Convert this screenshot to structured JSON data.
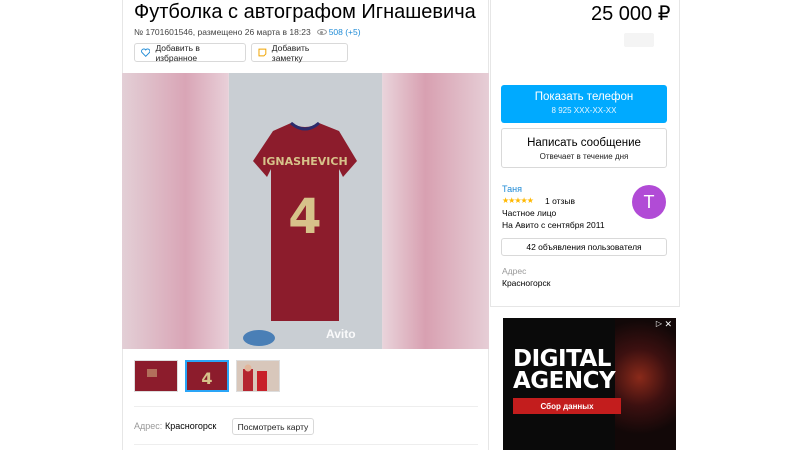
{
  "listing": {
    "title": "Футболка с автографом Игнашевича",
    "price": "25 000 ₽",
    "meta_text": "№ 1701601546, размещено 26 марта в 18:23",
    "views": "508 (+5)"
  },
  "actions": {
    "favorite_label": "Добавить в избранное",
    "note_label": "Добавить заметку"
  },
  "gallery": {
    "watermark": "Avito",
    "shirt_name": "IGNASHEVICH",
    "shirt_number": "4",
    "thumbnail_count": 3,
    "active_thumbnail": 2
  },
  "address": {
    "label": "Адрес:",
    "value": "Красногорск",
    "map_button": "Посмотреть карту"
  },
  "contact": {
    "phone_button": "Показать телефон",
    "phone_masked": "8 925 XXX-XX-XX",
    "message_button": "Написать сообщение",
    "message_sub": "Отвечает в течение дня"
  },
  "seller": {
    "name": "Таня",
    "stars": "★★★★★",
    "reviews": "1 отзыв",
    "type": "Частное лицо",
    "since": "На Авито с сентября 2011",
    "avatar_letter": "Т",
    "avatar_color": "#b14bd6",
    "ads_button": "42 объявления пользователя",
    "address_label": "Адрес",
    "address_value": "Красногорск"
  },
  "ad_banner": {
    "line1": "DIGITAL",
    "line2": "AGENCY",
    "cta": "Сбор данных",
    "close": "✕",
    "info": "▷"
  },
  "colors": {
    "accent": "#00aaff",
    "link": "#1f8bd6",
    "star": "#ffb800",
    "shirt": "#8c1c2c"
  }
}
